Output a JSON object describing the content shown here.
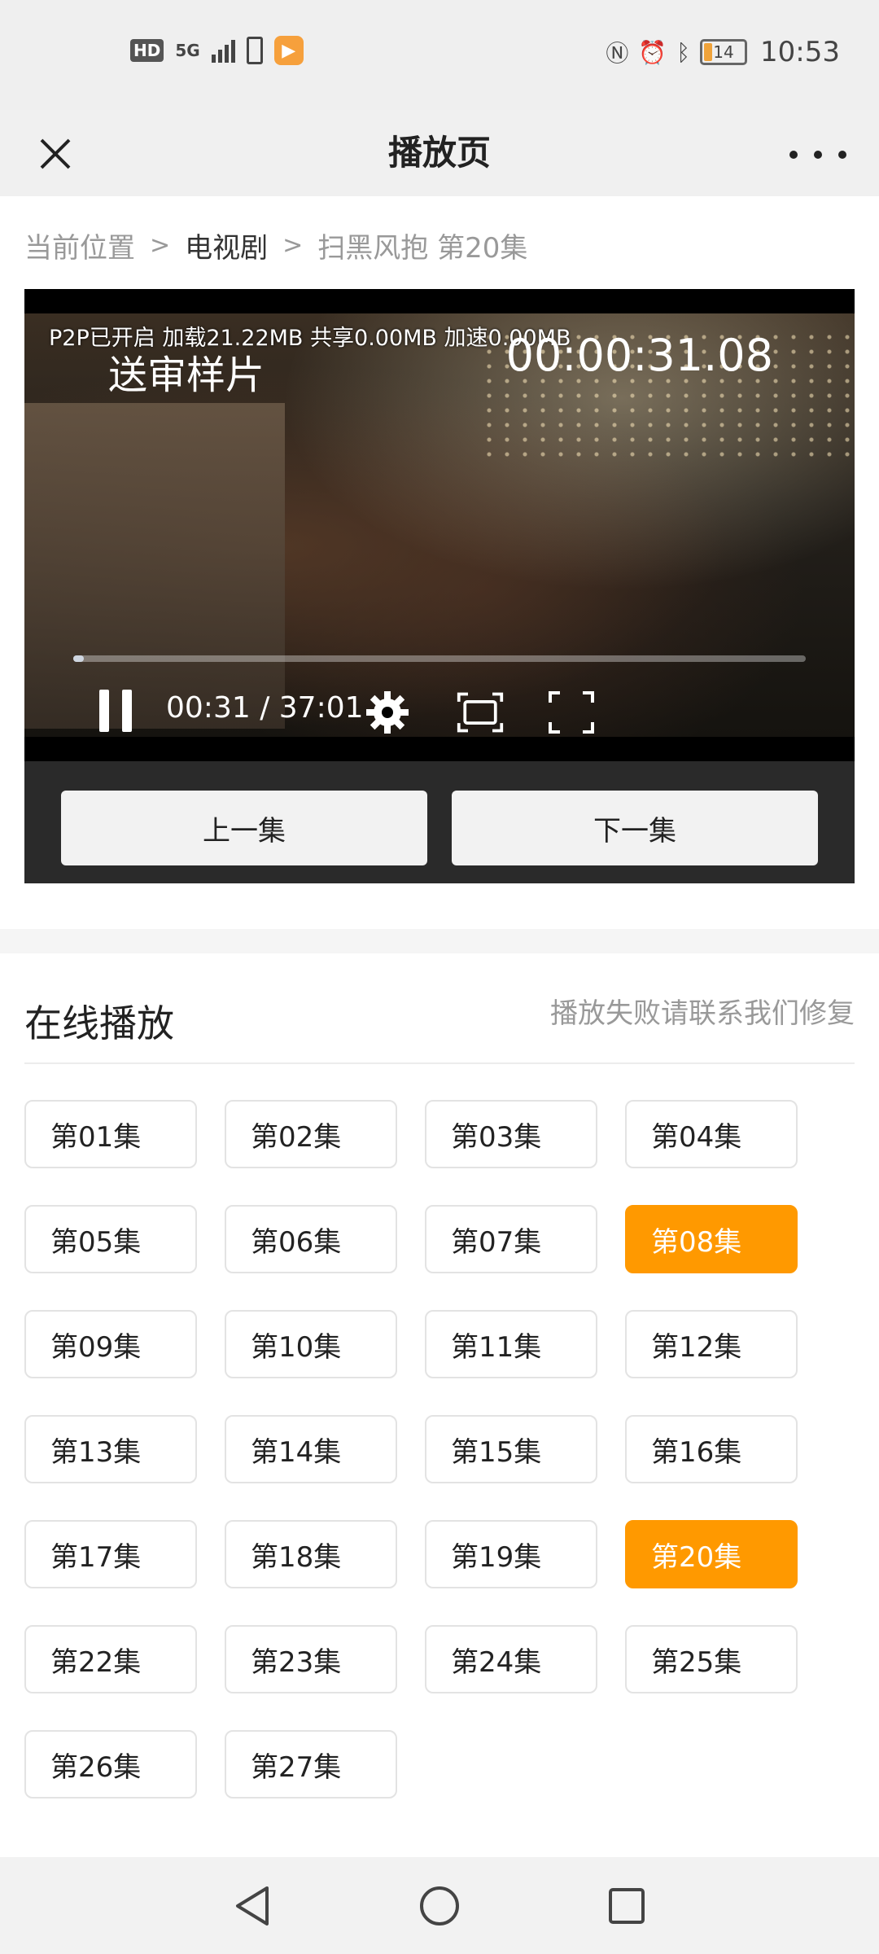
{
  "status_bar": {
    "hd": "HD",
    "network": "5G",
    "battery_level": "14",
    "time": "10:53"
  },
  "header": {
    "title": "播放页"
  },
  "breadcrumb": {
    "items": [
      "当前位置",
      "电视剧",
      "扫黑风抱 第20集"
    ]
  },
  "player": {
    "p2p_info": "P2P已开启 加载21.22MB 共享0.00MB 加速0.00MB",
    "watermark": "送审样片",
    "overlay_time": "00:00:31.08",
    "timecode": "00:31 / 37:01",
    "progress_fraction": 0.014
  },
  "episode_nav": {
    "prev": "上一集",
    "next": "下一集"
  },
  "online": {
    "title": "在线播放",
    "note": "播放失败请联系我们修复"
  },
  "episodes": [
    "第01集",
    "第02集",
    "第03集",
    "第04集",
    "第05集",
    "第06集",
    "第07集",
    "第08集",
    "第09集",
    "第10集",
    "第11集",
    "第12集",
    "第13集",
    "第14集",
    "第15集",
    "第16集",
    "第17集",
    "第18集",
    "第19集",
    "第20集",
    "第22集",
    "第23集",
    "第24集",
    "第25集",
    "第26集",
    "第27集"
  ],
  "highlighted_episodes": [
    "第08集",
    "第20集"
  ],
  "colors": {
    "accent": "#ff9900"
  }
}
